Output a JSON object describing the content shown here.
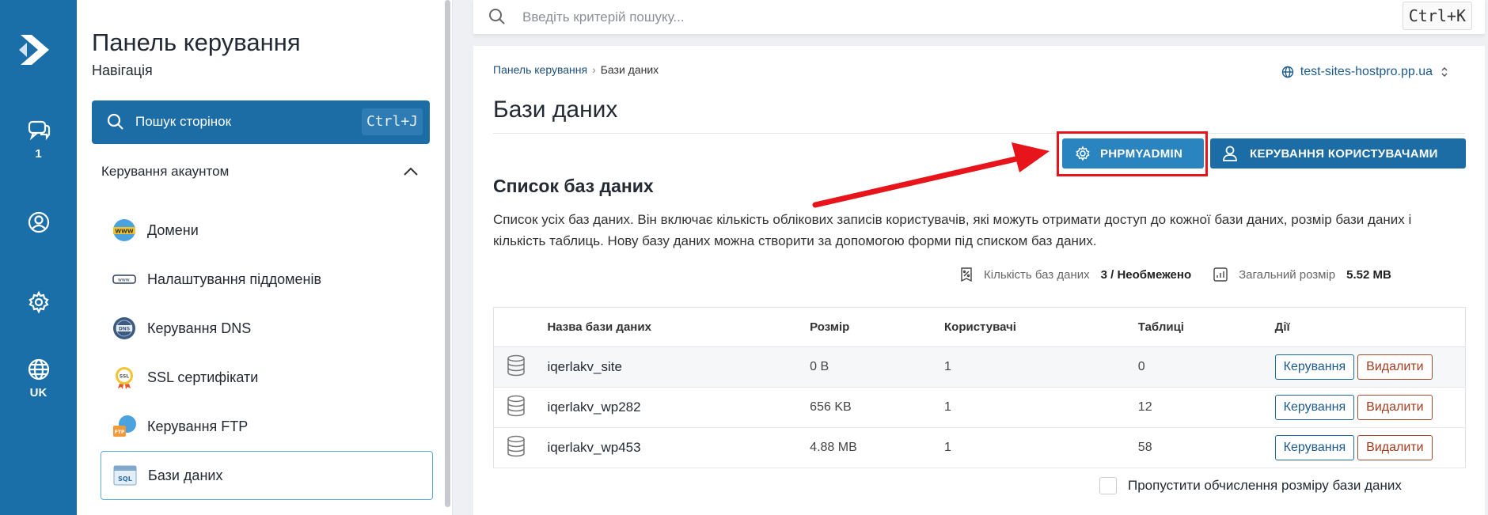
{
  "rail": {
    "items": [
      {
        "name": "chat-icon",
        "label": "1"
      },
      {
        "name": "user-icon",
        "label": ""
      },
      {
        "name": "gear-icon",
        "label": ""
      },
      {
        "name": "globe-icon",
        "label": "UK"
      }
    ],
    "color": "#1a6fa8"
  },
  "sidebar": {
    "title": "Панель керування",
    "subtitle": "Навігація",
    "search_label": "Пошук сторінок",
    "search_shortcut": "Ctrl+J",
    "section": "Керування акаунтом",
    "items": [
      {
        "label": "Домени",
        "icon": "www-icon"
      },
      {
        "label": "Налаштування піддоменів",
        "icon": "subdomain-icon"
      },
      {
        "label": "Керування DNS",
        "icon": "dns-icon"
      },
      {
        "label": "SSL сертифікати",
        "icon": "ssl-icon"
      },
      {
        "label": "Керування FTP",
        "icon": "ftp-icon"
      },
      {
        "label": "Бази даних",
        "icon": "sql-icon",
        "active": true
      }
    ]
  },
  "topsearch": {
    "placeholder": "Введіть критерій пошуку...",
    "shortcut": "Ctrl+K"
  },
  "main": {
    "breadcrumb": [
      "Панель керування",
      "Бази даних"
    ],
    "domain": "test-sites-hostpro.pp.ua",
    "title": "Бази даних",
    "buttons": {
      "phpmyadmin": "PHPMYADMIN",
      "manage_users": "КЕРУВАННЯ КОРИСТУВАЧАМИ"
    },
    "list_title": "Список баз даних",
    "list_desc": "Список усіх баз даних. Він включає кількість облікових записів користувачів, які можуть отримати доступ до кожної бази даних, розмір бази даних і кількість таблиць. Нову базу даних можна створити за допомогою форми під списком баз даних.",
    "stats": {
      "count_label": "Кількість баз даних",
      "count_value": "3 / Необмежено",
      "size_label": "Загальний розмір",
      "size_value": "5.52 MB"
    },
    "table": {
      "headers": [
        "Назва бази даних",
        "Розмір",
        "Користувачі",
        "Таблиці",
        "Дії"
      ],
      "rows": [
        {
          "name": "iqerlakv_site",
          "size": "0 B",
          "users": "1",
          "tables": "0"
        },
        {
          "name": "iqerlakv_wp282",
          "size": "656 KB",
          "users": "1",
          "tables": "12"
        },
        {
          "name": "iqerlakv_wp453",
          "size": "4.88 MB",
          "users": "1",
          "tables": "58"
        }
      ],
      "manage_label": "Керування",
      "delete_label": "Видалити"
    },
    "skip_label": "Пропустити обчислення розміру бази даних"
  },
  "colors": {
    "primary": "#1c6ca5",
    "highlight": "#e8141b",
    "delete": "#a33b1e"
  }
}
